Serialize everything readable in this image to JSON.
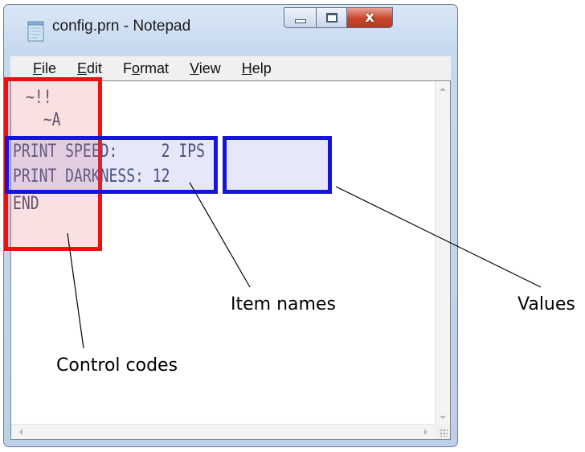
{
  "window": {
    "title": "config.prn - Notepad",
    "close_glyph": "x",
    "icon": "notepad-icon"
  },
  "menu": [
    {
      "pre": "",
      "u": "F",
      "post": "ile"
    },
    {
      "pre": "",
      "u": "E",
      "post": "dit"
    },
    {
      "pre": "F",
      "u": "o",
      "post": "rmat"
    },
    {
      "pre": "",
      "u": "V",
      "post": "iew"
    },
    {
      "pre": "",
      "u": "H",
      "post": "elp"
    }
  ],
  "editor": {
    "lines": [
      "~!!",
      "  ~A",
      "PRINT SPEED:     2 IPS",
      "PRINT DARKNESS: 12",
      "END"
    ]
  },
  "callouts": {
    "control_codes": "Control codes",
    "item_names": "Item names",
    "values": "Values"
  },
  "colors": {
    "control_box": "#ee1111",
    "item_box": "#1414dd",
    "close_button": "#c8452c"
  }
}
